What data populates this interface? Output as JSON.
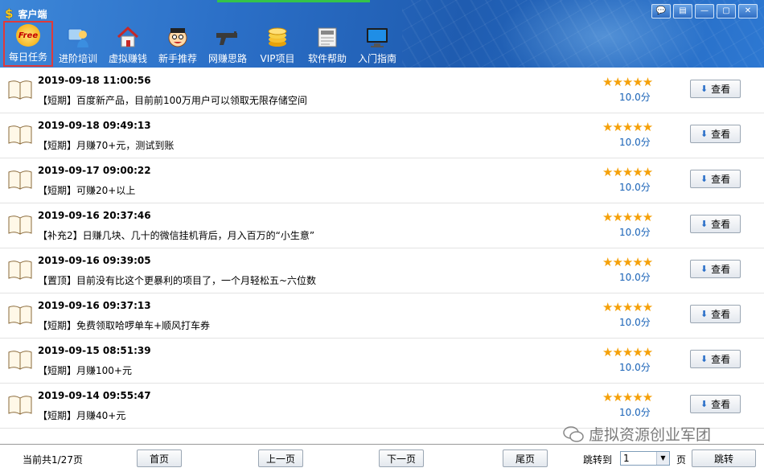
{
  "window": {
    "title": "客户端",
    "logo_glyph": "$",
    "controls": [
      "💬",
      "▤",
      "—",
      "▢",
      "✕"
    ]
  },
  "toolbar": {
    "items": [
      {
        "label": "每日任务",
        "icon": "free-badge-icon",
        "badge": "Free",
        "selected": true
      },
      {
        "label": "进阶培训",
        "icon": "training-icon"
      },
      {
        "label": "虚拟赚钱",
        "icon": "house-icon"
      },
      {
        "label": "新手推荐",
        "icon": "face-icon"
      },
      {
        "label": "网赚思路",
        "icon": "gun-icon"
      },
      {
        "label": "VIP项目",
        "icon": "coins-icon"
      },
      {
        "label": "软件帮助",
        "icon": "news-icon"
      },
      {
        "label": "入门指南",
        "icon": "monitor-icon"
      }
    ]
  },
  "tasks": [
    {
      "date": "2019-09-18 11:00:56",
      "desc": "【短期】百度新产品，目前前100万用户可以领取无限存储空间",
      "stars": "★★★★★",
      "score": "10.0分",
      "button": "查看"
    },
    {
      "date": "2019-09-18 09:49:13",
      "desc": "【短期】月赚70+元，测试到账",
      "stars": "★★★★★",
      "score": "10.0分",
      "button": "查看"
    },
    {
      "date": "2019-09-17 09:00:22",
      "desc": "【短期】可赚20+以上",
      "stars": "★★★★★",
      "score": "10.0分",
      "button": "查看"
    },
    {
      "date": "2019-09-16 20:37:46",
      "desc": "【补充2】日赚几块、几十的微信挂机背后，月入百万的“小生意”",
      "stars": "★★★★★",
      "score": "10.0分",
      "button": "查看"
    },
    {
      "date": "2019-09-16 09:39:05",
      "desc": "【置顶】目前没有比这个更暴利的项目了，一个月轻松五~六位数",
      "stars": "★★★★★",
      "score": "10.0分",
      "button": "查看"
    },
    {
      "date": "2019-09-16 09:37:13",
      "desc": "【短期】免费领取哈啰单车+顺风打车券",
      "stars": "★★★★★",
      "score": "10.0分",
      "button": "查看"
    },
    {
      "date": "2019-09-15 08:51:39",
      "desc": "【短期】月赚100+元",
      "stars": "★★★★★",
      "score": "10.0分",
      "button": "查看"
    },
    {
      "date": "2019-09-14 09:55:47",
      "desc": "【短期】月赚40+元",
      "stars": "★★★★★",
      "score": "10.0分",
      "button": "查看"
    }
  ],
  "pager": {
    "info": "当前共1/27页",
    "first": "首页",
    "prev": "上一页",
    "next": "下一页",
    "last": "尾页",
    "jump_label": "跳转到",
    "page_value": "1",
    "page_unit": "页",
    "go": "跳转"
  },
  "watermark": "虚拟资源创业军团",
  "colors": {
    "header": "#2b6fc7",
    "star": "#f5a10a",
    "score": "#1862b7",
    "selected_border": "#e03a3a"
  }
}
